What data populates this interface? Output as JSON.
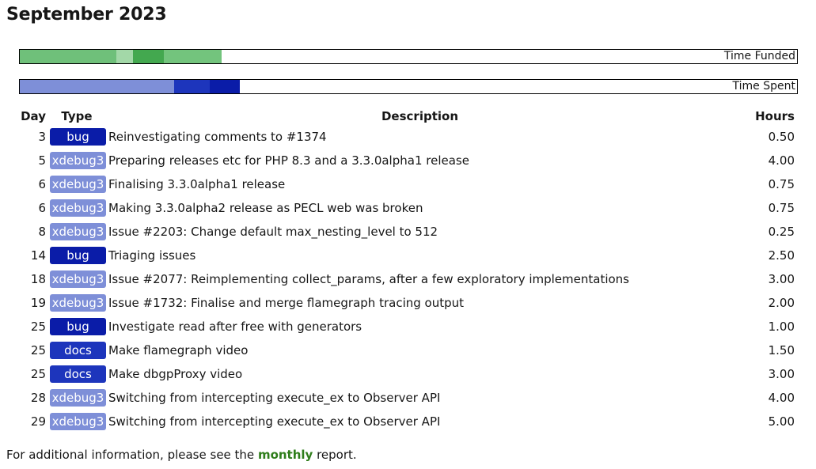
{
  "title": "September 2023",
  "funded_bar": {
    "label": "Time Funded",
    "segments": [
      {
        "fraction": 0.124,
        "color": "#6fc07a"
      },
      {
        "fraction": 0.021,
        "color": "#a3d8a8"
      },
      {
        "fraction": 0.04,
        "color": "#43a84f"
      },
      {
        "fraction": 0.074,
        "color": "#73c47d"
      }
    ]
  },
  "spent_bar": {
    "label": "Time Spent",
    "segments": [
      {
        "fraction": 0.199,
        "color": "#7e8fd8"
      },
      {
        "fraction": 0.046,
        "color": "#1d35bc"
      },
      {
        "fraction": 0.039,
        "color": "#0a1ca8"
      }
    ]
  },
  "table": {
    "headers": {
      "day": "Day",
      "type": "Type",
      "description": "Description",
      "hours": "Hours"
    },
    "type_colors": {
      "bug": "#0a1ca8",
      "xdebug3": "#7e8fd8",
      "docs": "#1d35bc"
    },
    "rows": [
      {
        "day": "3",
        "type": "bug",
        "description": "Reinvestigating comments to #1374",
        "hours": "0.50"
      },
      {
        "day": "5",
        "type": "xdebug3",
        "description": "Preparing releases etc for PHP 8.3 and a 3.3.0alpha1 release",
        "hours": "4.00"
      },
      {
        "day": "6",
        "type": "xdebug3",
        "description": "Finalising 3.3.0alpha1 release",
        "hours": "0.75"
      },
      {
        "day": "6",
        "type": "xdebug3",
        "description": "Making 3.3.0alpha2 release as PECL web was broken",
        "hours": "0.75"
      },
      {
        "day": "8",
        "type": "xdebug3",
        "description": "Issue #2203: Change default max_nesting_level to 512",
        "hours": "0.25"
      },
      {
        "day": "14",
        "type": "bug",
        "description": "Triaging issues",
        "hours": "2.50"
      },
      {
        "day": "18",
        "type": "xdebug3",
        "description": "Issue #2077: Reimplementing collect_params, after a few exploratory implementations",
        "hours": "3.00"
      },
      {
        "day": "19",
        "type": "xdebug3",
        "description": "Issue #1732: Finalise and merge flamegraph tracing output",
        "hours": "2.00"
      },
      {
        "day": "25",
        "type": "bug",
        "description": "Investigate read after free with generators",
        "hours": "1.00"
      },
      {
        "day": "25",
        "type": "docs",
        "description": "Make flamegraph video",
        "hours": "1.50"
      },
      {
        "day": "25",
        "type": "docs",
        "description": "Make dbgpProxy video",
        "hours": "3.00"
      },
      {
        "day": "28",
        "type": "xdebug3",
        "description": "Switching from intercepting execute_ex to Observer API",
        "hours": "4.00"
      },
      {
        "day": "29",
        "type": "xdebug3",
        "description": "Switching from intercepting execute_ex to Observer API",
        "hours": "5.00"
      }
    ]
  },
  "footer": {
    "prefix": "For additional information, please see the ",
    "link_text": "monthly",
    "suffix": " report."
  }
}
